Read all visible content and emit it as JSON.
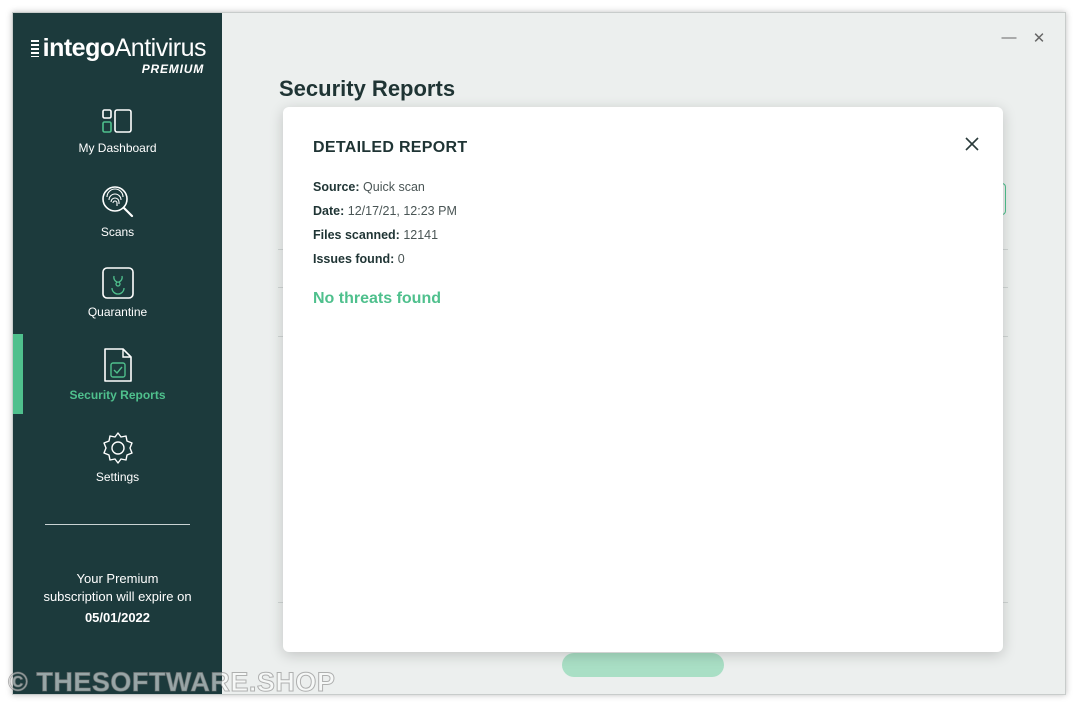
{
  "app": {
    "logo_word1": "intego",
    "logo_word2": "Antivirus",
    "logo_tier": "PREMIUM"
  },
  "sidebar": {
    "items": [
      {
        "label": "My Dashboard",
        "icon": "dashboard-icon"
      },
      {
        "label": "Scans",
        "icon": "fingerprint-search-icon"
      },
      {
        "label": "Quarantine",
        "icon": "biohazard-icon"
      },
      {
        "label": "Security Reports",
        "icon": "report-document-icon",
        "active": true
      },
      {
        "label": "Settings",
        "icon": "gear-icon"
      }
    ],
    "subscription_text": "Your Premium subscription will expire on",
    "subscription_date": "05/01/2022"
  },
  "window": {
    "minimize": "—",
    "close": "✕"
  },
  "main": {
    "title": "Security Reports"
  },
  "modal": {
    "title": "DETAILED REPORT",
    "fields": [
      {
        "label": "Source:",
        "value": "Quick scan"
      },
      {
        "label": "Date:",
        "value": "12/17/21, 12:23 PM"
      },
      {
        "label": "Files scanned:",
        "value": "12141"
      },
      {
        "label": "Issues found:",
        "value": "0"
      }
    ],
    "result": "No threats found"
  },
  "watermark": "© THESOFTWARE.SHOP",
  "colors": {
    "sidebar_bg": "#1c3a3c",
    "accent": "#4fc08d",
    "content_bg": "#ecefee"
  }
}
